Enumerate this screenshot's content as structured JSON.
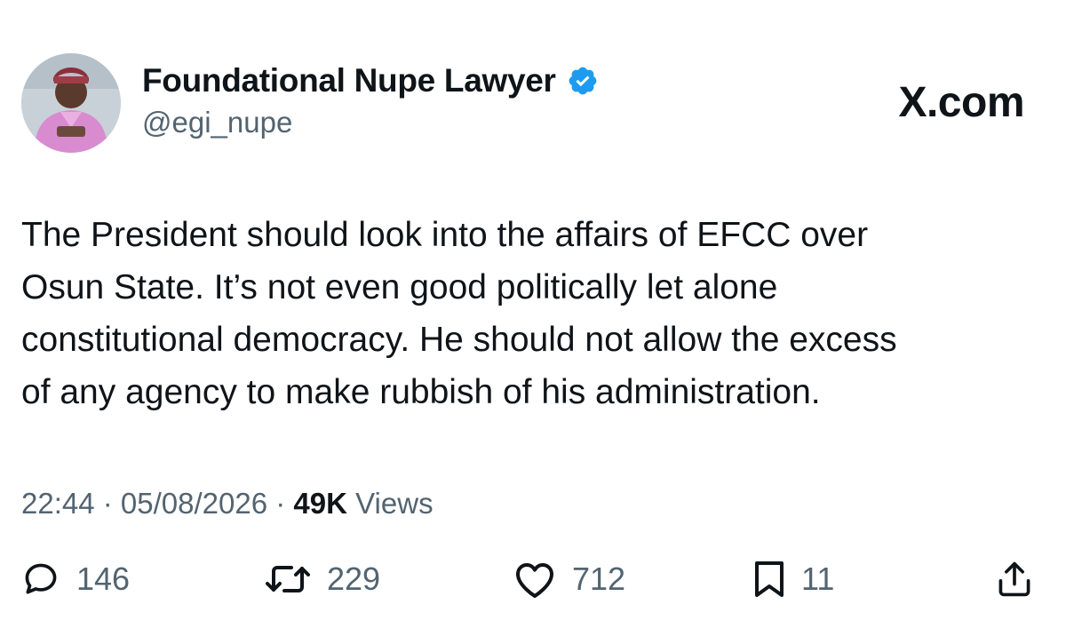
{
  "author": {
    "display_name": "Foundational Nupe Lawyer",
    "handle": "@egi_nupe",
    "verified": true
  },
  "site_label": "X.com",
  "tweet": {
    "lines": [
      "The President should look into the affairs of EFCC over",
      "Osun State. It’s not even good politically let alone",
      "constitutional democracy. He should not allow the excess",
      "of any agency to make rubbish of his administration."
    ]
  },
  "meta": {
    "time": "22:44",
    "date": "05/08/2026",
    "separator": " · ",
    "views_count": "49K",
    "views_label": " Views"
  },
  "actions": {
    "replies": "146",
    "reposts": "229",
    "likes": "712",
    "bookmarks": "11"
  },
  "colors": {
    "text": "#0f1419",
    "secondary": "#536471",
    "verified_blue": "#1d9bf0",
    "background": "#ffffff"
  },
  "icons": [
    "verified-badge-icon",
    "reply-icon",
    "repost-icon",
    "like-icon",
    "bookmark-icon",
    "share-icon"
  ]
}
